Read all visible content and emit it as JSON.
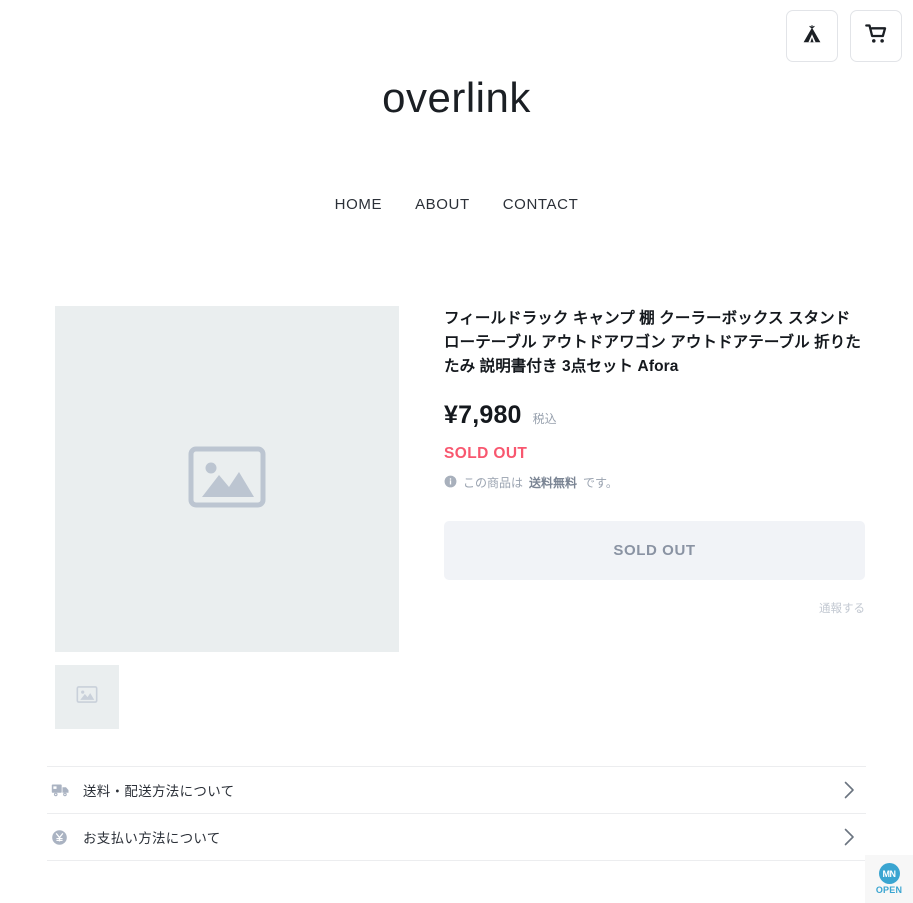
{
  "header": {
    "logo": "overlink",
    "icons": [
      {
        "name": "teepee-icon",
        "label": "teepee"
      },
      {
        "name": "cart-icon",
        "label": "cart"
      }
    ],
    "nav": [
      {
        "label": "HOME"
      },
      {
        "label": "ABOUT"
      },
      {
        "label": "CONTACT"
      }
    ]
  },
  "product": {
    "title": "フィールドラック キャンプ 棚 クーラーボックス スタンド ローテーブル アウトドアワゴン アウトドアテーブル 折りたたみ 説明書付き 3点セット Afora",
    "price": "¥7,980",
    "tax_label": "税込",
    "stock_status": "SOLD OUT",
    "shipping_note_prefix": "この商品は",
    "shipping_note_strong": "送料無料",
    "shipping_note_suffix": "です。",
    "buy_button_label": "SOLD OUT",
    "report_link": "通報する",
    "gallery": {
      "main_image_alt": "image-placeholder",
      "thumbnails": [
        {
          "alt": "image-placeholder"
        }
      ]
    }
  },
  "accordion": [
    {
      "icon": "truck-icon",
      "label": "送料・配送方法について"
    },
    {
      "icon": "yen-coin-icon",
      "label": "お支払い方法について"
    }
  ],
  "corner_badge": {
    "mark": "MN",
    "label": "OPEN"
  },
  "colors": {
    "soldout": "#f8576f",
    "button_bg": "#f1f3f7",
    "button_text": "#8a93a3",
    "placeholder_bg": "#eaeeef",
    "badge": "#3aa5d1",
    "muted": "#9aa3b0"
  }
}
